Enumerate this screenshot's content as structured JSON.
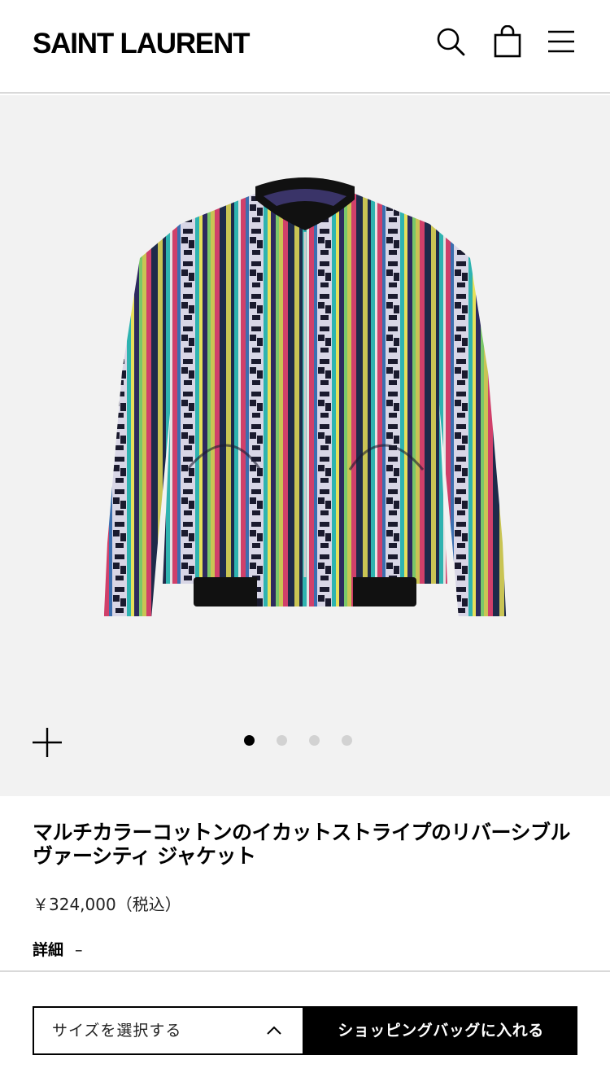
{
  "header": {
    "brand": "SAINT LAURENT",
    "icons": [
      "search-icon",
      "shopping-bag-icon",
      "menu-icon"
    ]
  },
  "gallery": {
    "image": "multicolor ikat stripe varsity jacket",
    "slide_count": 4,
    "active_slide": 1,
    "zoom_icon": "plus-icon"
  },
  "product": {
    "title": "マルチカラーコットンのイカットストライプのリバーシブル ヴァーシティ ジャケット",
    "price": "￥324,000（税込）",
    "details_label": "詳細",
    "details_toggle": "–"
  },
  "footer": {
    "size_select_label": "サイズを選択する",
    "add_to_bag_label": "ショッピングバッグに入れる"
  },
  "colors": {
    "background": "#ffffff",
    "gallery_bg": "#f2f2f2",
    "accent": "#000000",
    "inactive_dot": "#d2d2d2"
  }
}
